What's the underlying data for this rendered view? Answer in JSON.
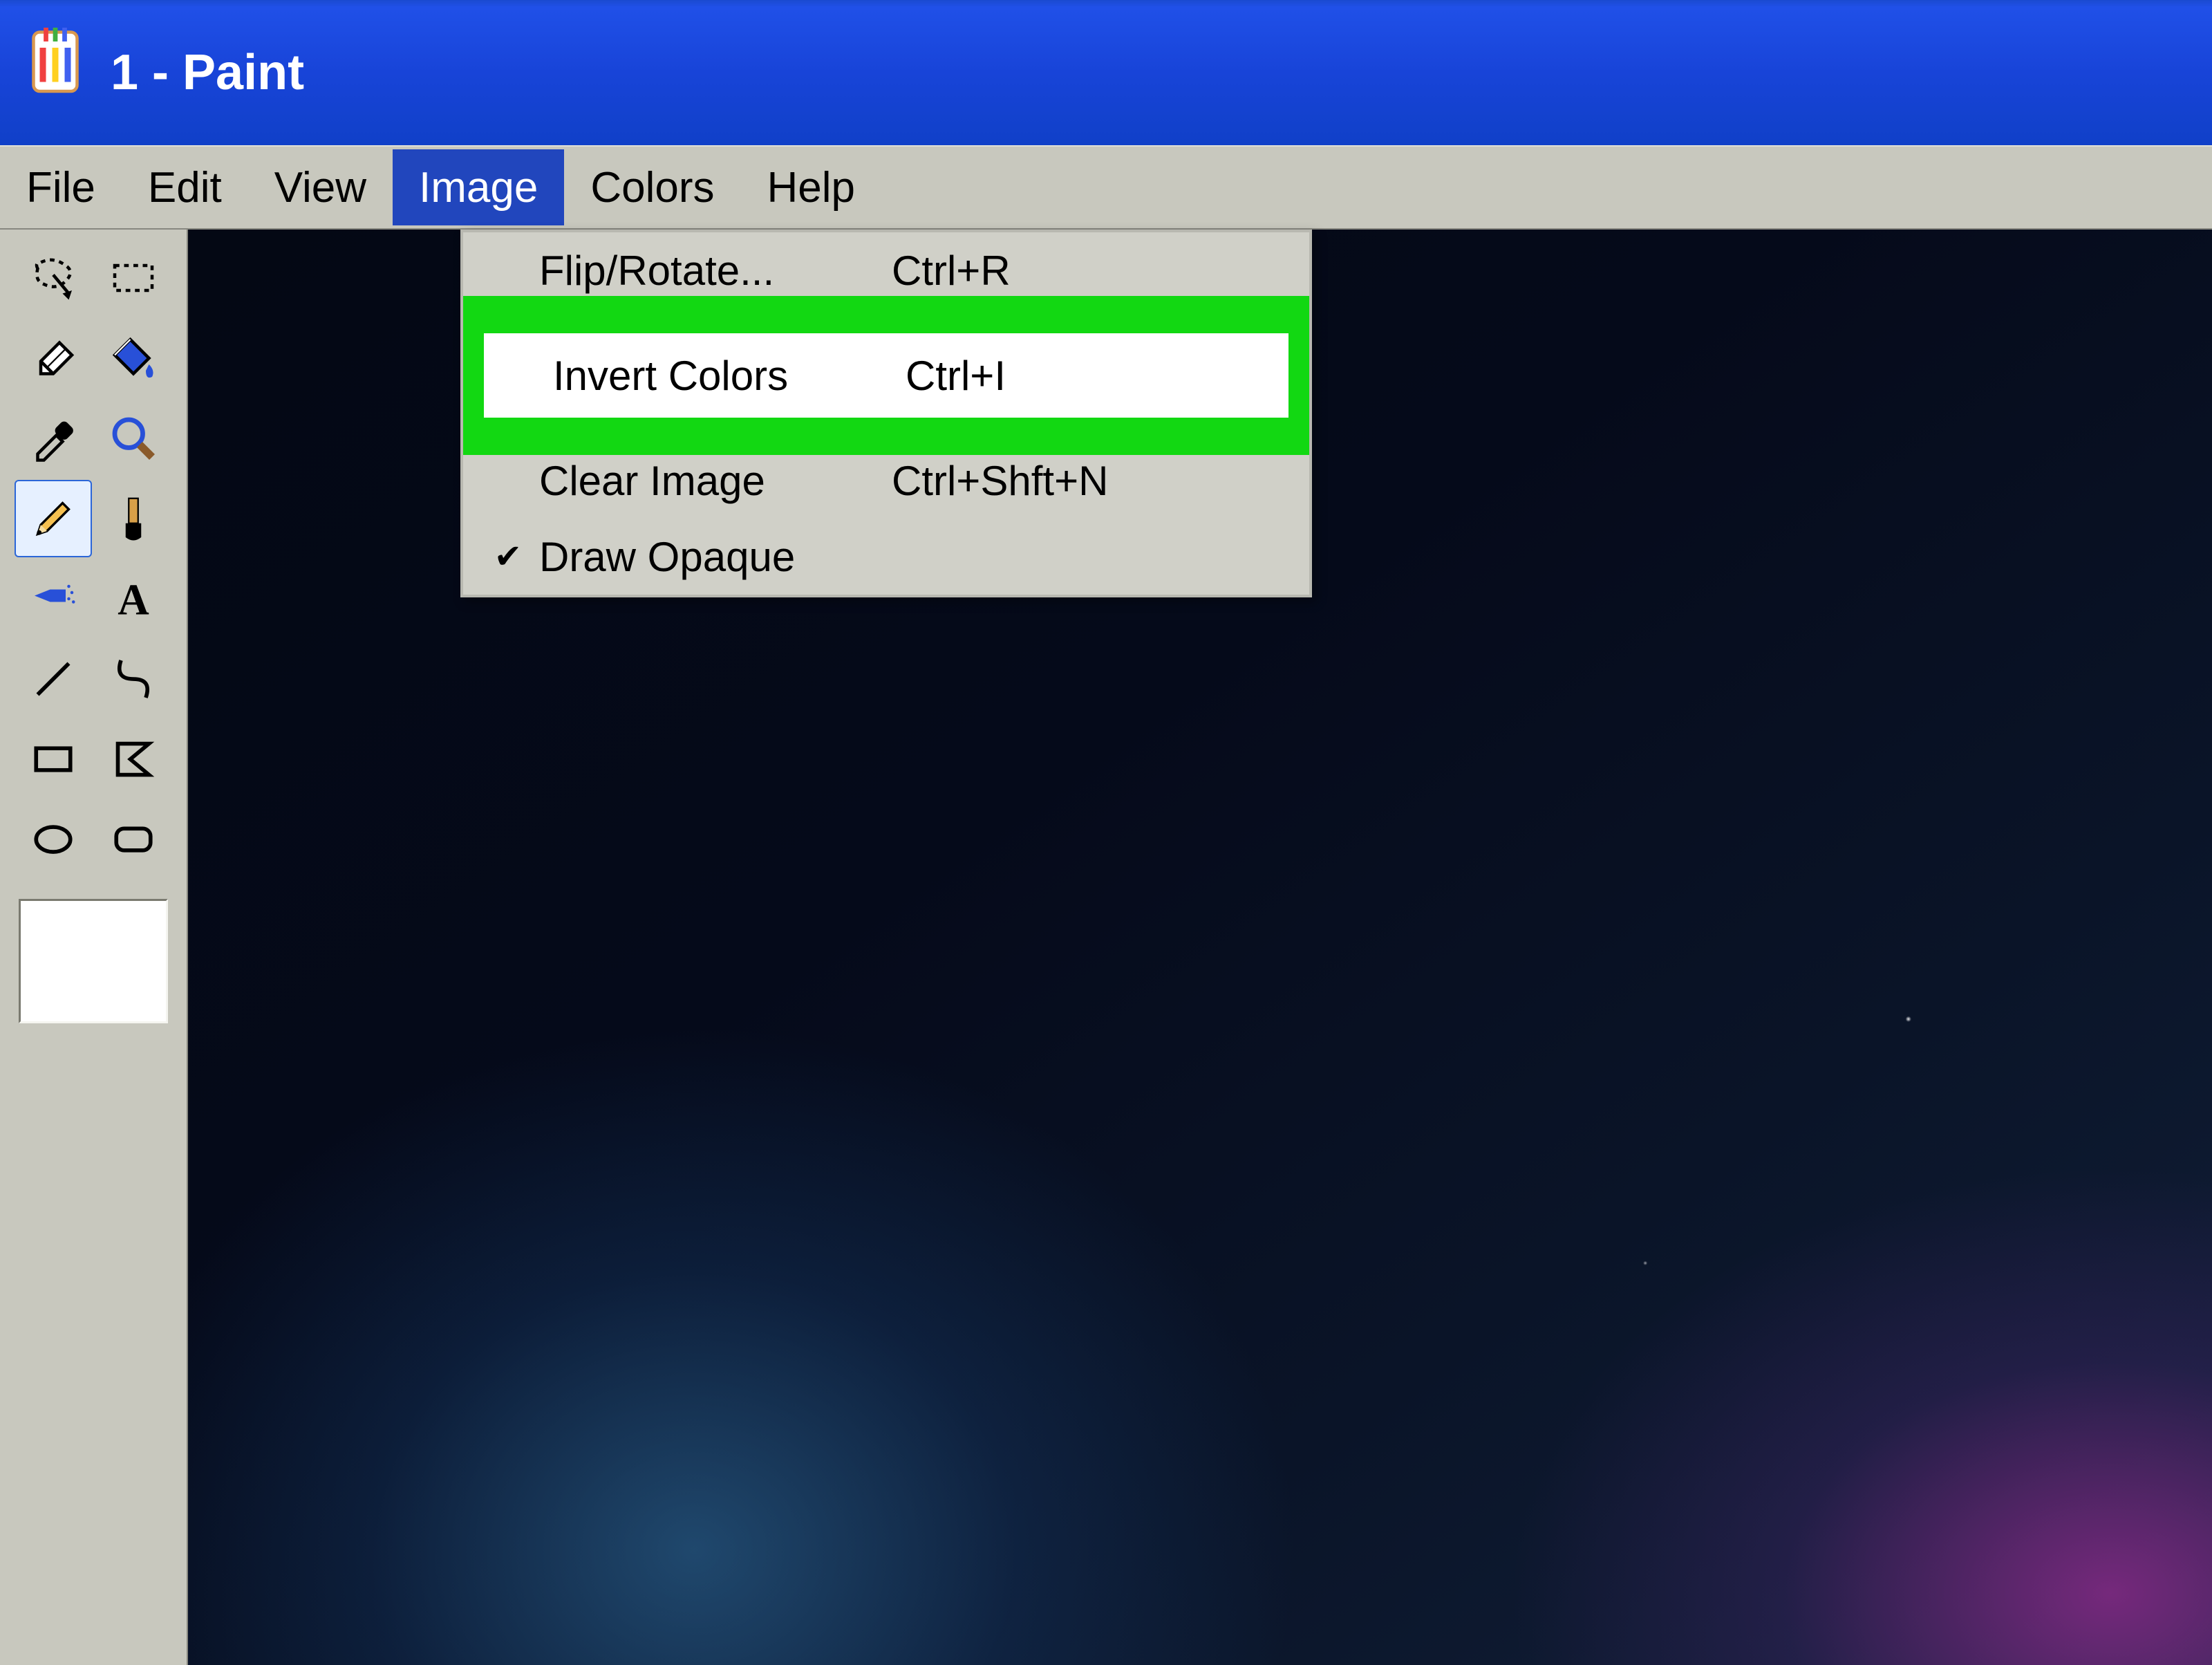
{
  "window": {
    "title": "1 - Paint"
  },
  "menubar": {
    "items": [
      "File",
      "Edit",
      "View",
      "Image",
      "Colors",
      "Help"
    ],
    "selected_index": 3
  },
  "dropdown": {
    "items": [
      {
        "label": "Flip/Rotate...",
        "shortcut": "Ctrl+R",
        "checked": false
      },
      {
        "label": "Invert Colors",
        "shortcut": "Ctrl+I",
        "checked": false,
        "highlight": true
      },
      {
        "label": "Clear Image",
        "shortcut": "Ctrl+Shft+N",
        "checked": false
      },
      {
        "label": "Draw Opaque",
        "shortcut": "",
        "checked": true
      }
    ]
  },
  "tools": {
    "names": [
      "free-form-select",
      "rectangle-select",
      "eraser",
      "fill",
      "eyedropper",
      "magnifier",
      "pencil",
      "brush",
      "airbrush",
      "text",
      "line",
      "curve",
      "rectangle",
      "polygon",
      "ellipse",
      "rounded-rectangle"
    ],
    "active_index": 6
  }
}
